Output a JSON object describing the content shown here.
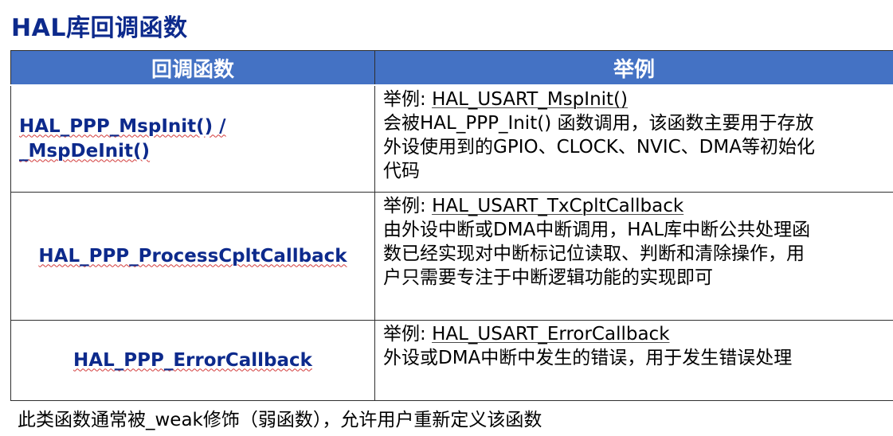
{
  "title": "HAL库回调函数",
  "table": {
    "headers": [
      "回调函数",
      "举例"
    ],
    "rows": [
      {
        "function_lines": [
          "HAL_PPP_MspInit() /",
          "_MspDeInit()"
        ],
        "example_prefix": "举例: ",
        "example_name": "HAL_USART_MspInit()",
        "desc_lines": [
          "会被HAL_PPP_Init() 函数调用，该函数主要用于存放",
          "外设使用到的GPIO、CLOCK、NVIC、DMA等初始化",
          "代码"
        ]
      },
      {
        "function_lines": [
          "HAL_PPP_ProcessCpltCallback"
        ],
        "example_prefix": "举例: ",
        "example_name": "HAL_USART_TxCpltCallback",
        "desc_lines": [
          "由外设中断或DMA中断调用，HAL库中断公共处理函",
          "数已经实现对中断标记位读取、判断和清除操作，用",
          "户只需要专注于中断逻辑功能的实现即可"
        ]
      },
      {
        "function_lines": [
          "HAL_PPP_ErrorCallback"
        ],
        "example_prefix": "举例: ",
        "example_name": "HAL_USART_ErrorCallback",
        "desc_lines": [
          "外设或DMA中断中发生的错误，用于发生错误处理"
        ]
      }
    ]
  },
  "footer": "此类函数通常被_weak修饰（弱函数），允许用户重新定义该函数",
  "colors": {
    "header_bg": "#4472c4",
    "title": "#0d2a8c",
    "function_text": "#0d2a8c"
  }
}
